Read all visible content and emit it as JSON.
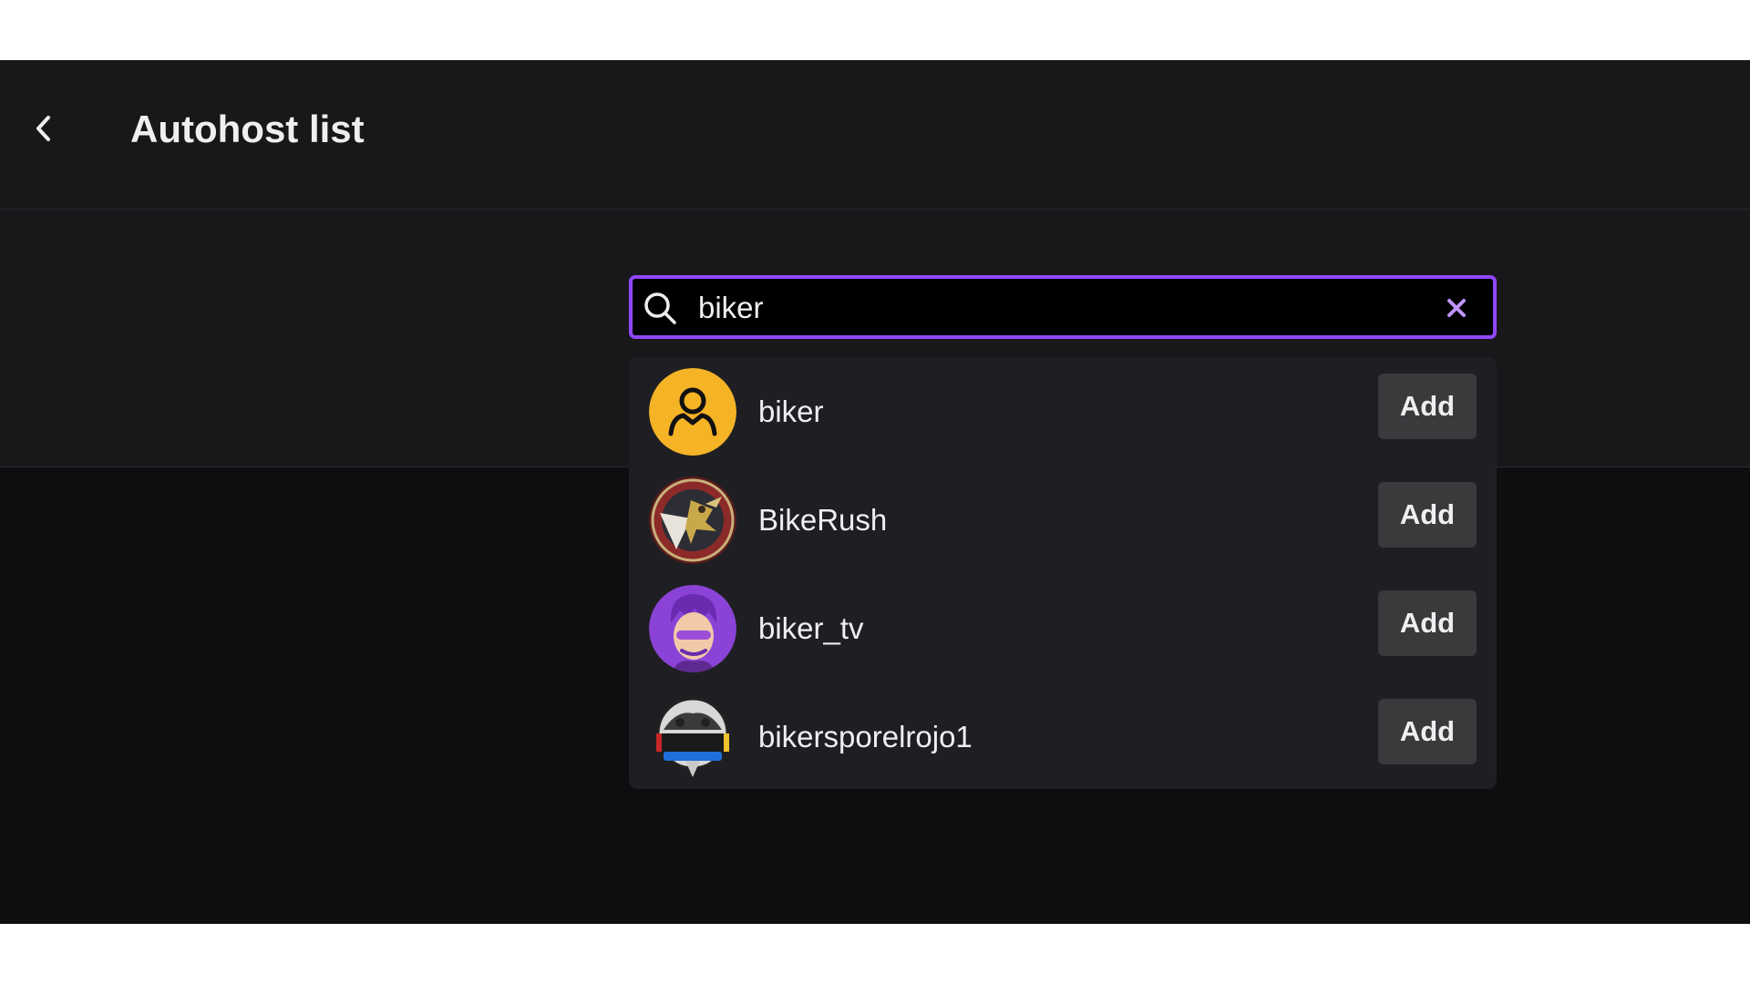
{
  "header": {
    "title": "Autohost list",
    "back_icon": "chevron-left-icon"
  },
  "search": {
    "value": "biker",
    "icon": "search-icon",
    "clear_icon": "close-icon"
  },
  "results": [
    {
      "name": "biker",
      "button": "Add",
      "avatar": "default-user-avatar"
    },
    {
      "name": "BikeRush",
      "button": "Add",
      "avatar": "eagle-emblem-avatar"
    },
    {
      "name": "biker_tv",
      "button": "Add",
      "avatar": "purple-cartoon-avatar"
    },
    {
      "name": "bikersporelrojo1",
      "button": "Add",
      "avatar": "bikers-colombia-badge-avatar"
    }
  ],
  "colors": {
    "accent": "#9147ff",
    "background": "#0e0e10",
    "surface": "#18181b",
    "dropdown": "#1f1f23",
    "button": "#3a3a3d",
    "clear_icon": "#bf94ff",
    "default_avatar": "#f5b326"
  }
}
